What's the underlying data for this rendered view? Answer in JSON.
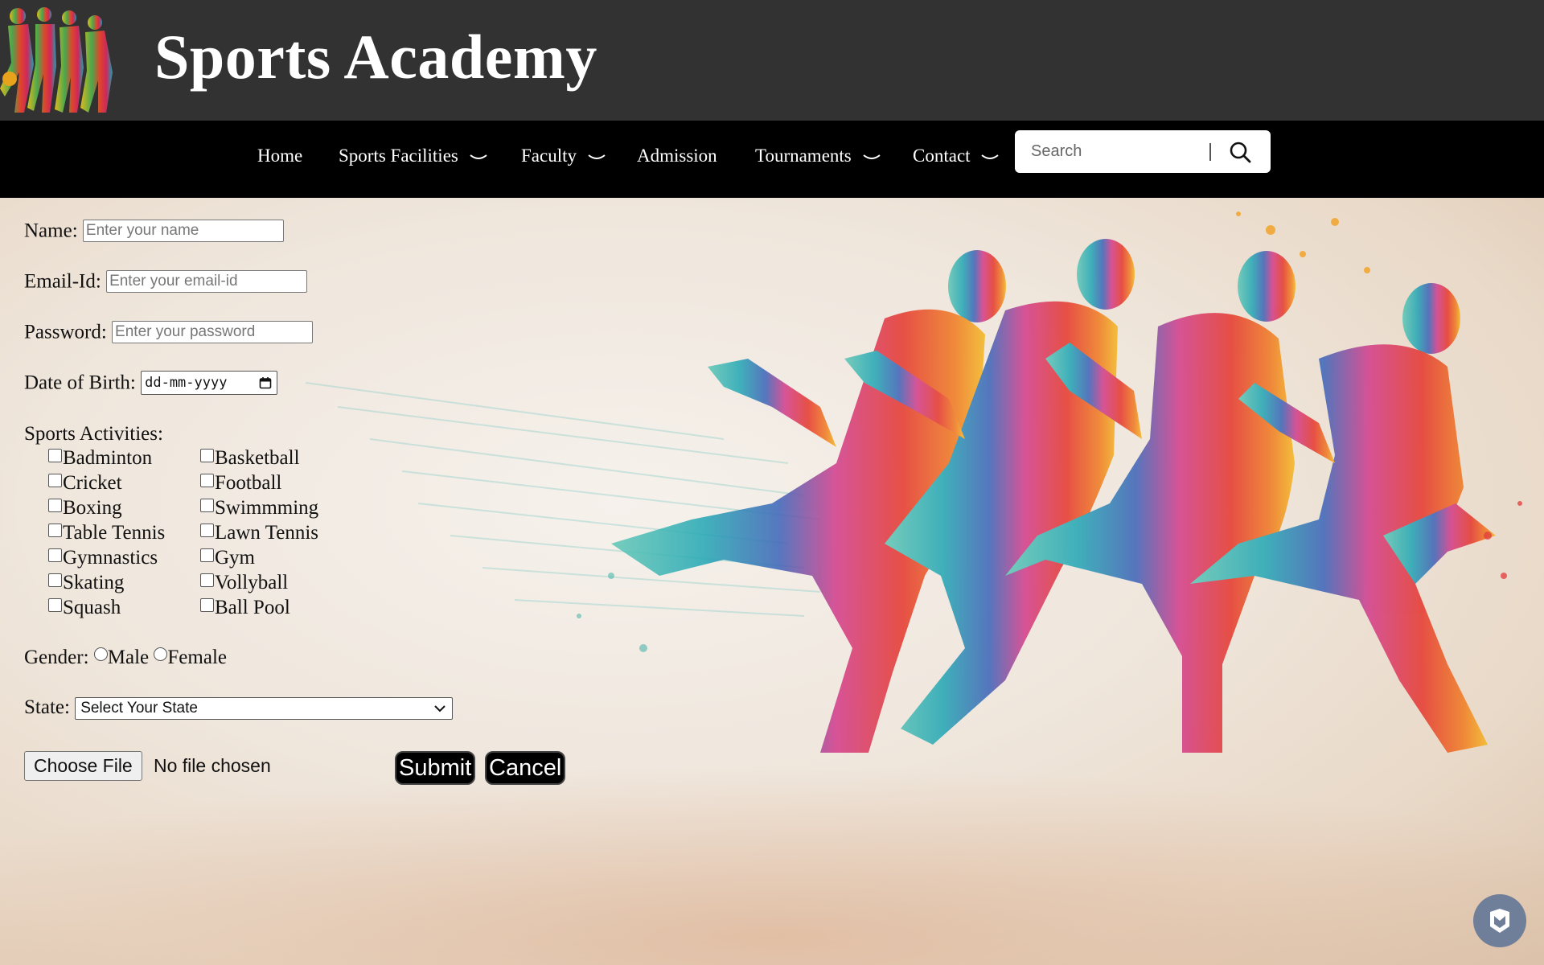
{
  "header": {
    "title": "Sports Academy",
    "logo": "athletes-silhouette-logo"
  },
  "nav": {
    "items": [
      {
        "label": "Home",
        "has_dropdown": false
      },
      {
        "label": "Sports Facilities",
        "has_dropdown": true
      },
      {
        "label": "Faculty",
        "has_dropdown": true
      },
      {
        "label": "Admission",
        "has_dropdown": false
      },
      {
        "label": "Tournaments",
        "has_dropdown": true
      },
      {
        "label": "Contact",
        "has_dropdown": true
      }
    ],
    "search": {
      "placeholder": "Search",
      "icon": "search-icon"
    }
  },
  "form": {
    "name": {
      "label": "Name:",
      "placeholder": "Enter your name"
    },
    "email": {
      "label": "Email-Id:",
      "placeholder": "Enter your email-id"
    },
    "password": {
      "label": "Password:",
      "placeholder": "Enter your password"
    },
    "dob": {
      "label": "Date of Birth:",
      "placeholder": "dd-mm-yyyy"
    },
    "sports": {
      "label": "Sports Activities:",
      "left": [
        "Badminton",
        "Cricket",
        "Boxing",
        "Table Tennis",
        "Gymnastics",
        "Skating",
        "Squash"
      ],
      "right": [
        "Basketball",
        "Football",
        "Swimmming",
        "Lawn Tennis",
        "Gym",
        "Vollyball",
        "Ball Pool"
      ]
    },
    "gender": {
      "label": "Gender:",
      "options": [
        "Male",
        "Female"
      ]
    },
    "state": {
      "label": "State:",
      "selected": "Select Your State"
    },
    "file": {
      "button": "Choose File",
      "status": "No file chosen"
    },
    "submit": "Submit",
    "cancel": "Cancel"
  },
  "colors": {
    "header_bg": "#333232",
    "nav_bg": "#000000",
    "floating_button": "#6f7f99"
  },
  "floating_button": {
    "icon": "shield-icon"
  }
}
